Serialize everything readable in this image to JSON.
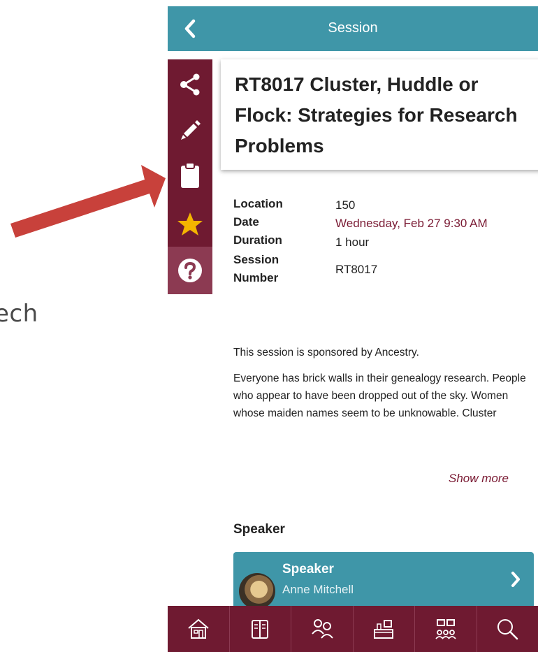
{
  "slide": {
    "partial_text": "ech"
  },
  "header": {
    "title": "Session",
    "back_icon": "chevron-left-icon"
  },
  "side_actions": [
    {
      "icon": "share-icon"
    },
    {
      "icon": "pencil-icon"
    },
    {
      "icon": "clipboard-icon"
    },
    {
      "icon": "star-icon"
    },
    {
      "icon": "help-icon"
    }
  ],
  "session": {
    "title": "RT8017 Cluster, Huddle or Flock: Strategies for Research Problems",
    "details": {
      "location_label": "Location",
      "location": "150",
      "date_label": "Date",
      "date": "Wednesday, Feb 27 9:30 AM",
      "duration_label": "Duration",
      "duration": "1 hour",
      "number_label_1": "Session",
      "number_label_2": "Number",
      "number": "RT8017"
    },
    "sponsor": "This session is sponsored by Ancestry.",
    "description": "Everyone has brick walls in their genealogy research. People who appear to have been dropped out of the sky. Women whose maiden names seem to be unknowable. Cluster",
    "show_more": "Show more"
  },
  "speaker": {
    "heading": "Speaker",
    "card_label": "Speaker",
    "name": "Anne Mitchell"
  },
  "bottom_nav": [
    {
      "icon": "home-icon"
    },
    {
      "icon": "book-icon"
    },
    {
      "icon": "people-icon"
    },
    {
      "icon": "exhibit-hall-icon"
    },
    {
      "icon": "network-icon"
    },
    {
      "icon": "search-icon"
    }
  ],
  "colors": {
    "teal": "#3f96a8",
    "maroon": "#6f1a31",
    "arrow": "#c8413b",
    "star": "#f4b400"
  }
}
